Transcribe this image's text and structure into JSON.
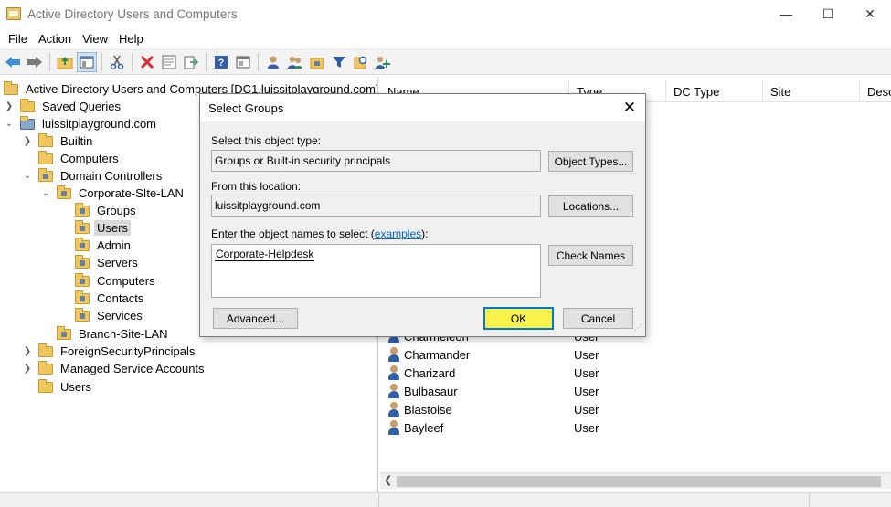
{
  "window": {
    "title": "Active Directory Users and Computers",
    "controls": {
      "minimize": "—",
      "maximize": "☐",
      "close": "✕"
    }
  },
  "menu": [
    "File",
    "Action",
    "View",
    "Help"
  ],
  "toolbar_icons": [
    "back-arrow-icon",
    "forward-arrow-icon",
    "up-folder-icon",
    "show-hide-tree-icon",
    "cut-icon",
    "delete-icon",
    "properties-icon",
    "export-icon",
    "help-icon",
    "console-icon",
    "new-user-icon",
    "new-group-icon",
    "new-ou-icon",
    "filter-icon",
    "find-icon",
    "add-to-group-icon"
  ],
  "tree": {
    "root": "Active Directory Users and Computers [DC1.luissitplayground.com]",
    "saved_queries": "Saved Queries",
    "domain": "luissitplayground.com",
    "builtin": "Builtin",
    "computers": "Computers",
    "domain_controllers": "Domain Controllers",
    "corporate_site": "Corporate-SIte-LAN",
    "groups": "Groups",
    "users": "Users",
    "admin": "Admin",
    "servers": "Servers",
    "computers2": "Computers",
    "contacts": "Contacts",
    "services": "Services",
    "branch_site": "Branch-Site-LAN",
    "foreign": "ForeignSecurityPrincipals",
    "managed": "Managed Service Accounts",
    "users_root": "Users"
  },
  "list": {
    "columns": [
      "Name",
      "Type",
      "DC Type",
      "Site",
      "Desc"
    ],
    "rows": [
      {
        "name": "Charmeleon",
        "type": "User"
      },
      {
        "name": "Charmander",
        "type": "User"
      },
      {
        "name": "Charizard",
        "type": "User"
      },
      {
        "name": "Bulbasaur",
        "type": "User"
      },
      {
        "name": "Blastoise",
        "type": "User"
      },
      {
        "name": "Bayleef",
        "type": "User"
      }
    ]
  },
  "dialog": {
    "title": "Select Groups",
    "object_type_label": "Select this object type:",
    "object_type_value": "Groups or Built-in security principals",
    "object_types_button": "Object Types...",
    "location_label": "From this location:",
    "location_value": "luissitplayground.com",
    "locations_button": "Locations...",
    "enter_label_prefix": "Enter the object names to select (",
    "examples_link": "examples",
    "enter_label_suffix": "):",
    "entered_names": "Corporate-Helpdesk",
    "check_names_button": "Check Names",
    "advanced_button": "Advanced...",
    "ok_button": "OK",
    "cancel_button": "Cancel",
    "highlight_color": "#f8f24a"
  }
}
